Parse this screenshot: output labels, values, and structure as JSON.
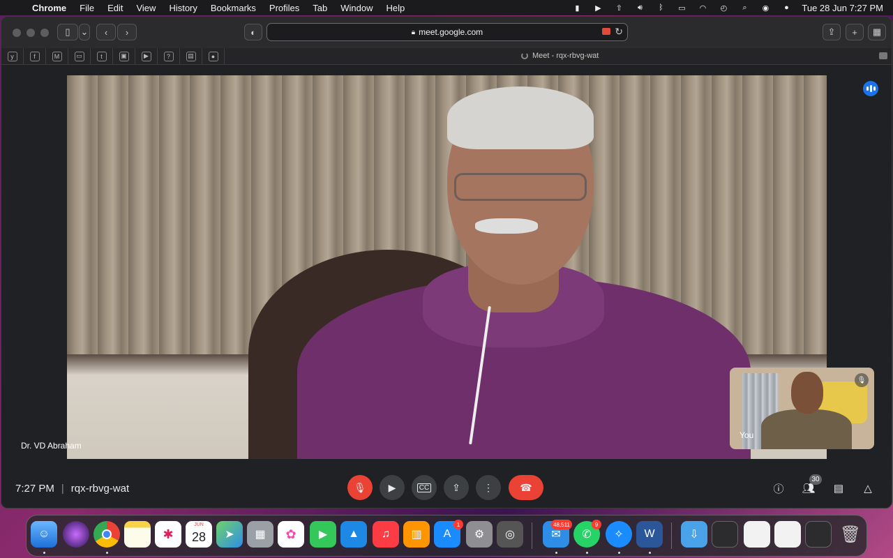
{
  "menubar": {
    "app_name": "Chrome",
    "items": [
      "File",
      "Edit",
      "View",
      "History",
      "Bookmarks",
      "Profiles",
      "Tab",
      "Window",
      "Help"
    ],
    "datetime": "Tue 28 Jun  7:27 PM"
  },
  "browser": {
    "url": "meet.google.com",
    "tab_title": "Meet - rqx-rbvg-wat"
  },
  "meet": {
    "speaker_name": "Dr. VD Abraham",
    "self_label": "You",
    "time": "7:27 PM",
    "meeting_code": "rqx-rbvg-wat",
    "participants_count": "30",
    "cc_label": "CC"
  },
  "dock": {
    "calendar_month": "JUN",
    "calendar_day": "28",
    "mail_badge": "48,511",
    "appstore_badge": "1",
    "whatsapp_badge": "9"
  },
  "colors": {
    "red": "#ea4335",
    "control_grey": "#3c4043",
    "speaking_blue": "#1a73e8"
  }
}
